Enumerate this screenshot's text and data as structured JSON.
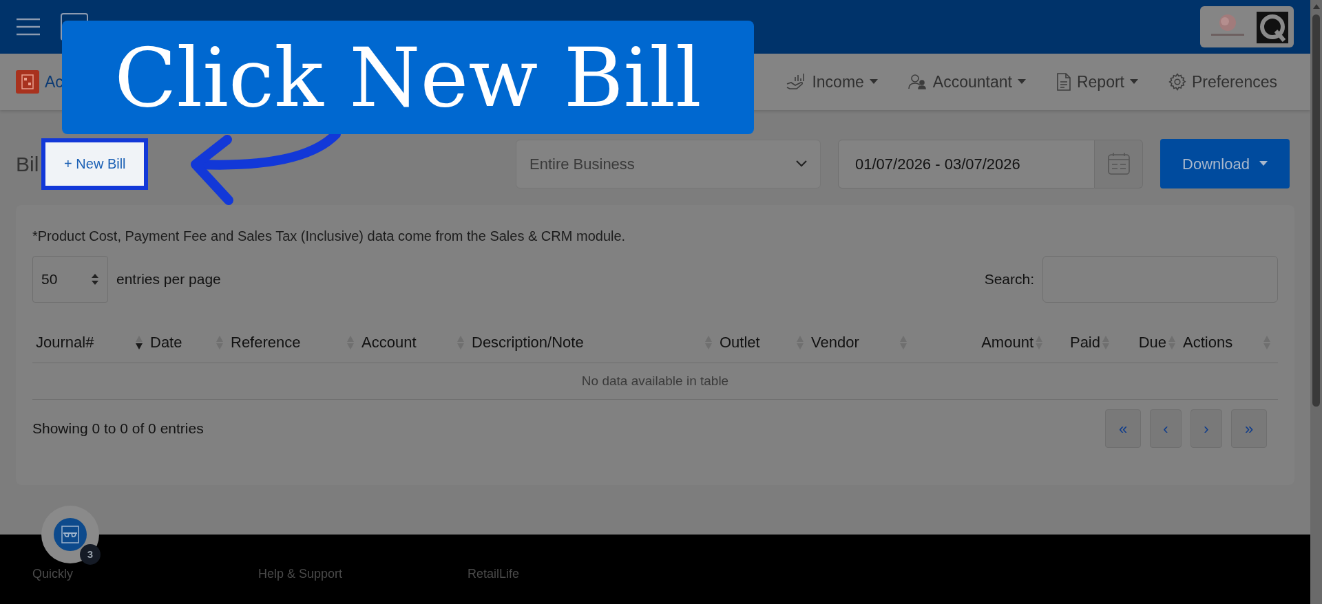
{
  "nav": {
    "items": [
      {
        "label": "Ac",
        "has_caret": false
      },
      {
        "label": "Income",
        "has_caret": true
      },
      {
        "label": "Accountant",
        "has_caret": true
      },
      {
        "label": "Report",
        "has_caret": true
      },
      {
        "label": "Preferences",
        "has_caret": false
      }
    ]
  },
  "page": {
    "title": "Bil",
    "new_button": "+ New Bill",
    "scope_select": {
      "value": "Entire Business"
    },
    "date_range": {
      "value": "01/07/2026 - 03/07/2026"
    },
    "download_button": "Download"
  },
  "card": {
    "note": "*Product Cost, Payment Fee and Sales Tax (Inclusive) data come from the Sales & CRM module.",
    "page_size": "50",
    "page_size_label": "entries per page",
    "search_label": "Search:",
    "columns": [
      {
        "label": "Journal#",
        "sorted": true
      },
      {
        "label": "Date",
        "sorted": false
      },
      {
        "label": "Reference",
        "sorted": false
      },
      {
        "label": "Account",
        "sorted": false
      },
      {
        "label": "Description/Note",
        "sorted": false
      },
      {
        "label": "Outlet",
        "sorted": false
      },
      {
        "label": "Vendor",
        "sorted": false
      },
      {
        "label": "Amount",
        "sorted": false
      },
      {
        "label": "Paid",
        "sorted": false
      },
      {
        "label": "Due",
        "sorted": false
      },
      {
        "label": "Actions",
        "sorted": false
      }
    ],
    "empty_text": "No data available in table",
    "info": "Showing 0 to 0 of 0 entries",
    "pagination": [
      "«",
      "‹",
      "›",
      "»"
    ]
  },
  "assistant_badge": {
    "count": "3"
  },
  "footer": {
    "links": [
      "Quickly",
      "Help & Support",
      "RetailLife"
    ]
  },
  "callout": {
    "text": "Click New Bill"
  }
}
